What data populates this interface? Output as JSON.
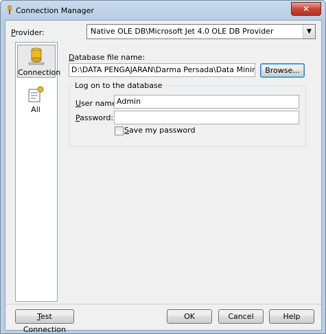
{
  "window": {
    "title": "Connection Manager",
    "close_glyph": "✕"
  },
  "provider": {
    "label": "Provider:",
    "value": "Native OLE DB\\Microsoft Jet 4.0 OLE DB Provider",
    "dropdown_glyph": "▼"
  },
  "nav": {
    "items": [
      {
        "label": "Connection",
        "icon": "database-icon",
        "selected": true
      },
      {
        "label": "All",
        "icon": "properties-icon",
        "selected": false
      }
    ]
  },
  "database": {
    "label": "Database file name:",
    "value": "D:\\DATA PENGAJARAN\\Darma Persada\\Data Mining\\referensi\\da",
    "browse_label": "Browse..."
  },
  "logon": {
    "group_title": "Log on to the database",
    "user_label": "User name:",
    "user_value": "Admin",
    "password_label": "Password:",
    "password_value": "",
    "save_password_label": "Save my password",
    "save_password_checked": false
  },
  "buttons": {
    "test": "Test Connection",
    "ok": "OK",
    "cancel": "Cancel",
    "help": "Help"
  }
}
